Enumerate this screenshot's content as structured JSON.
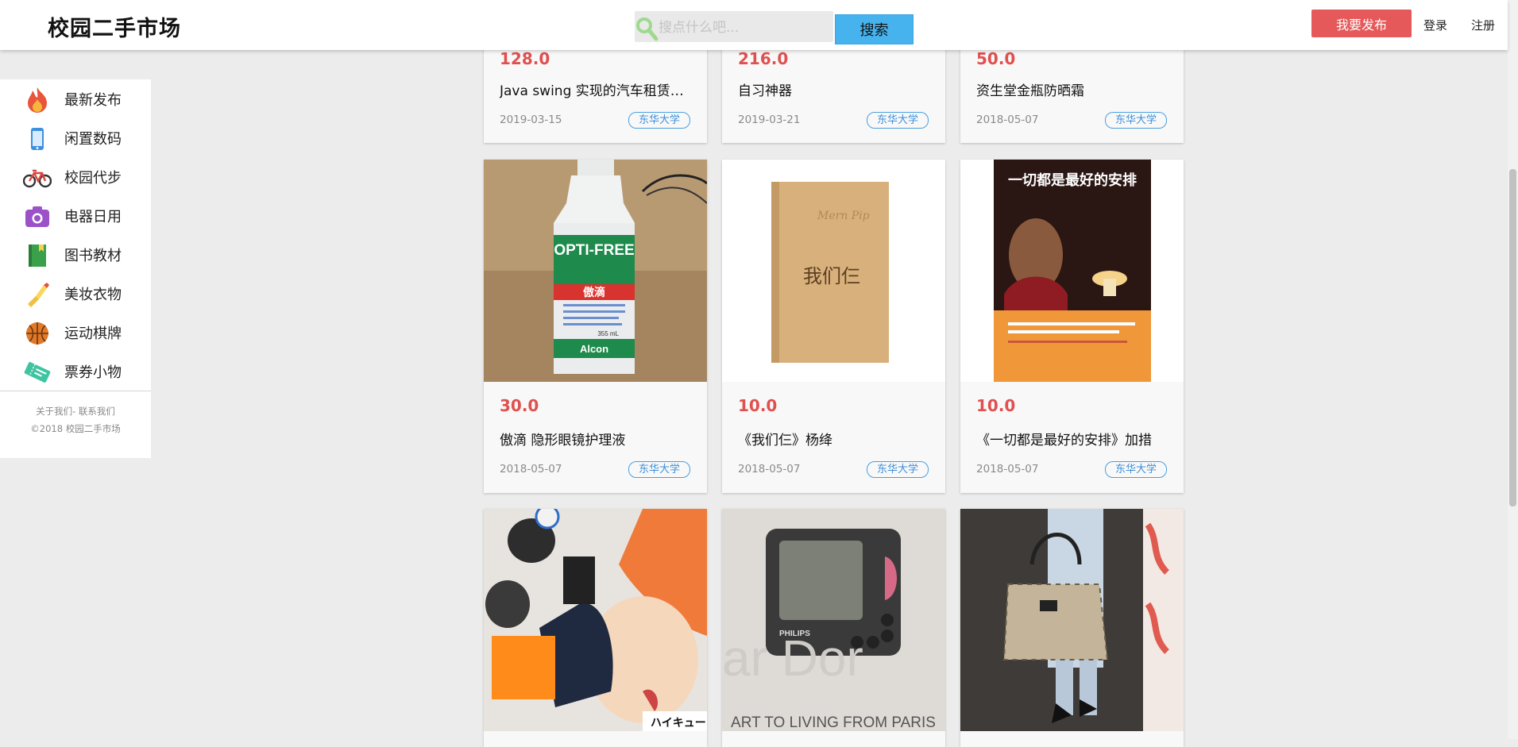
{
  "header": {
    "logo": "校园二手市场",
    "search_placeholder": "搜点什么吧...",
    "search_value": "",
    "search_button": "搜索",
    "publish_button": "我要发布",
    "login": "登录",
    "register": "注册"
  },
  "sidebar": {
    "categories": [
      {
        "label": "最新发布",
        "icon": "flame-icon"
      },
      {
        "label": "闲置数码",
        "icon": "phone-icon"
      },
      {
        "label": "校园代步",
        "icon": "bicycle-icon"
      },
      {
        "label": "电器日用",
        "icon": "camera-icon"
      },
      {
        "label": "图书教材",
        "icon": "book-icon"
      },
      {
        "label": "美妆衣物",
        "icon": "lipstick-icon"
      },
      {
        "label": "运动棋牌",
        "icon": "basketball-icon"
      },
      {
        "label": "票券小物",
        "icon": "ticket-icon"
      }
    ],
    "footer_about": "关于我们",
    "footer_sep": "-",
    "footer_contact": "联系我们",
    "copyright": "©2018 校园二手市场"
  },
  "products": [
    {
      "price": "128.0",
      "title": "Java swing 实现的汽车租赁…",
      "date": "2019-03-15",
      "school": "东华大学"
    },
    {
      "price": "216.0",
      "title": "自习神器",
      "date": "2019-03-21",
      "school": "东华大学"
    },
    {
      "price": "50.0",
      "title": "资生堂金瓶防晒霜",
      "date": "2018-05-07",
      "school": "东华大学"
    },
    {
      "price": "30.0",
      "title": "傲滴 隐形眼镜护理液",
      "date": "2018-05-07",
      "school": "东华大学",
      "image_text": {
        "brand": "OPTI-FREE",
        "sub": "傲滴",
        "maker": "Alcon",
        "vol": "355 mL"
      }
    },
    {
      "price": "10.0",
      "title": "《我们仨》杨绛",
      "date": "2018-05-07",
      "school": "东华大学",
      "image_text": {
        "book_title": "我们仨"
      }
    },
    {
      "price": "10.0",
      "title": "《一切都是最好的安排》加措",
      "date": "2018-05-07",
      "school": "东华大学",
      "image_text": {
        "book_title": "一切都是最好的安排"
      }
    },
    {
      "image": "anime-poster"
    },
    {
      "image": "philips-device",
      "image_text": {
        "brand": "PHILIPS",
        "caption": "ART TO LIVING FROM PARIS"
      }
    },
    {
      "image": "handbag"
    }
  ]
}
